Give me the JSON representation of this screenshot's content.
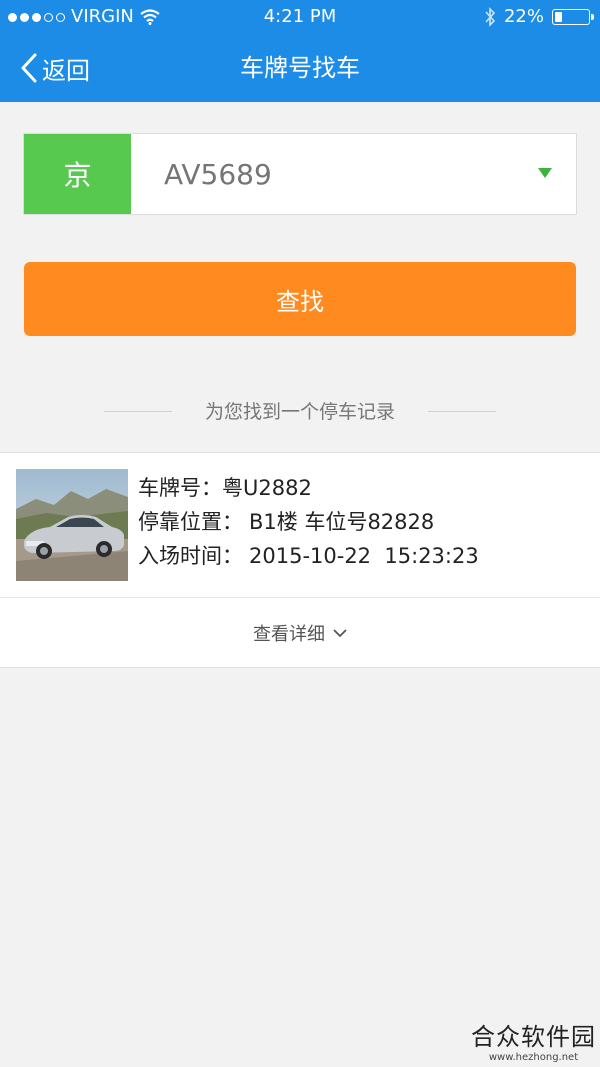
{
  "status_bar": {
    "carrier": "VIRGIN",
    "time": "4:21 PM",
    "battery": "22%",
    "battery_level": 0.22
  },
  "nav": {
    "back_label": "返回",
    "title": "车牌号找车"
  },
  "search": {
    "province": "京",
    "plate_placeholder": "AV5689",
    "button_label": "查找"
  },
  "result_summary": "为您找到一个停车记录",
  "record": {
    "plate_label": "车牌号：",
    "plate_value": "粤U2882",
    "location_label": "停靠位置：",
    "location_value": "B1楼 车位号82828",
    "entry_label": "入场时间：",
    "entry_value": "2015-10-22  15:23:23",
    "details_label": "查看详细"
  },
  "watermark": {
    "main": "合众软件园",
    "sub": "www.hezhong.net"
  },
  "colors": {
    "nav_bg": "#1d8ce6",
    "province_bg": "#57c94f",
    "button_bg": "#ff8a1f",
    "page_bg": "#f2f2f2"
  }
}
